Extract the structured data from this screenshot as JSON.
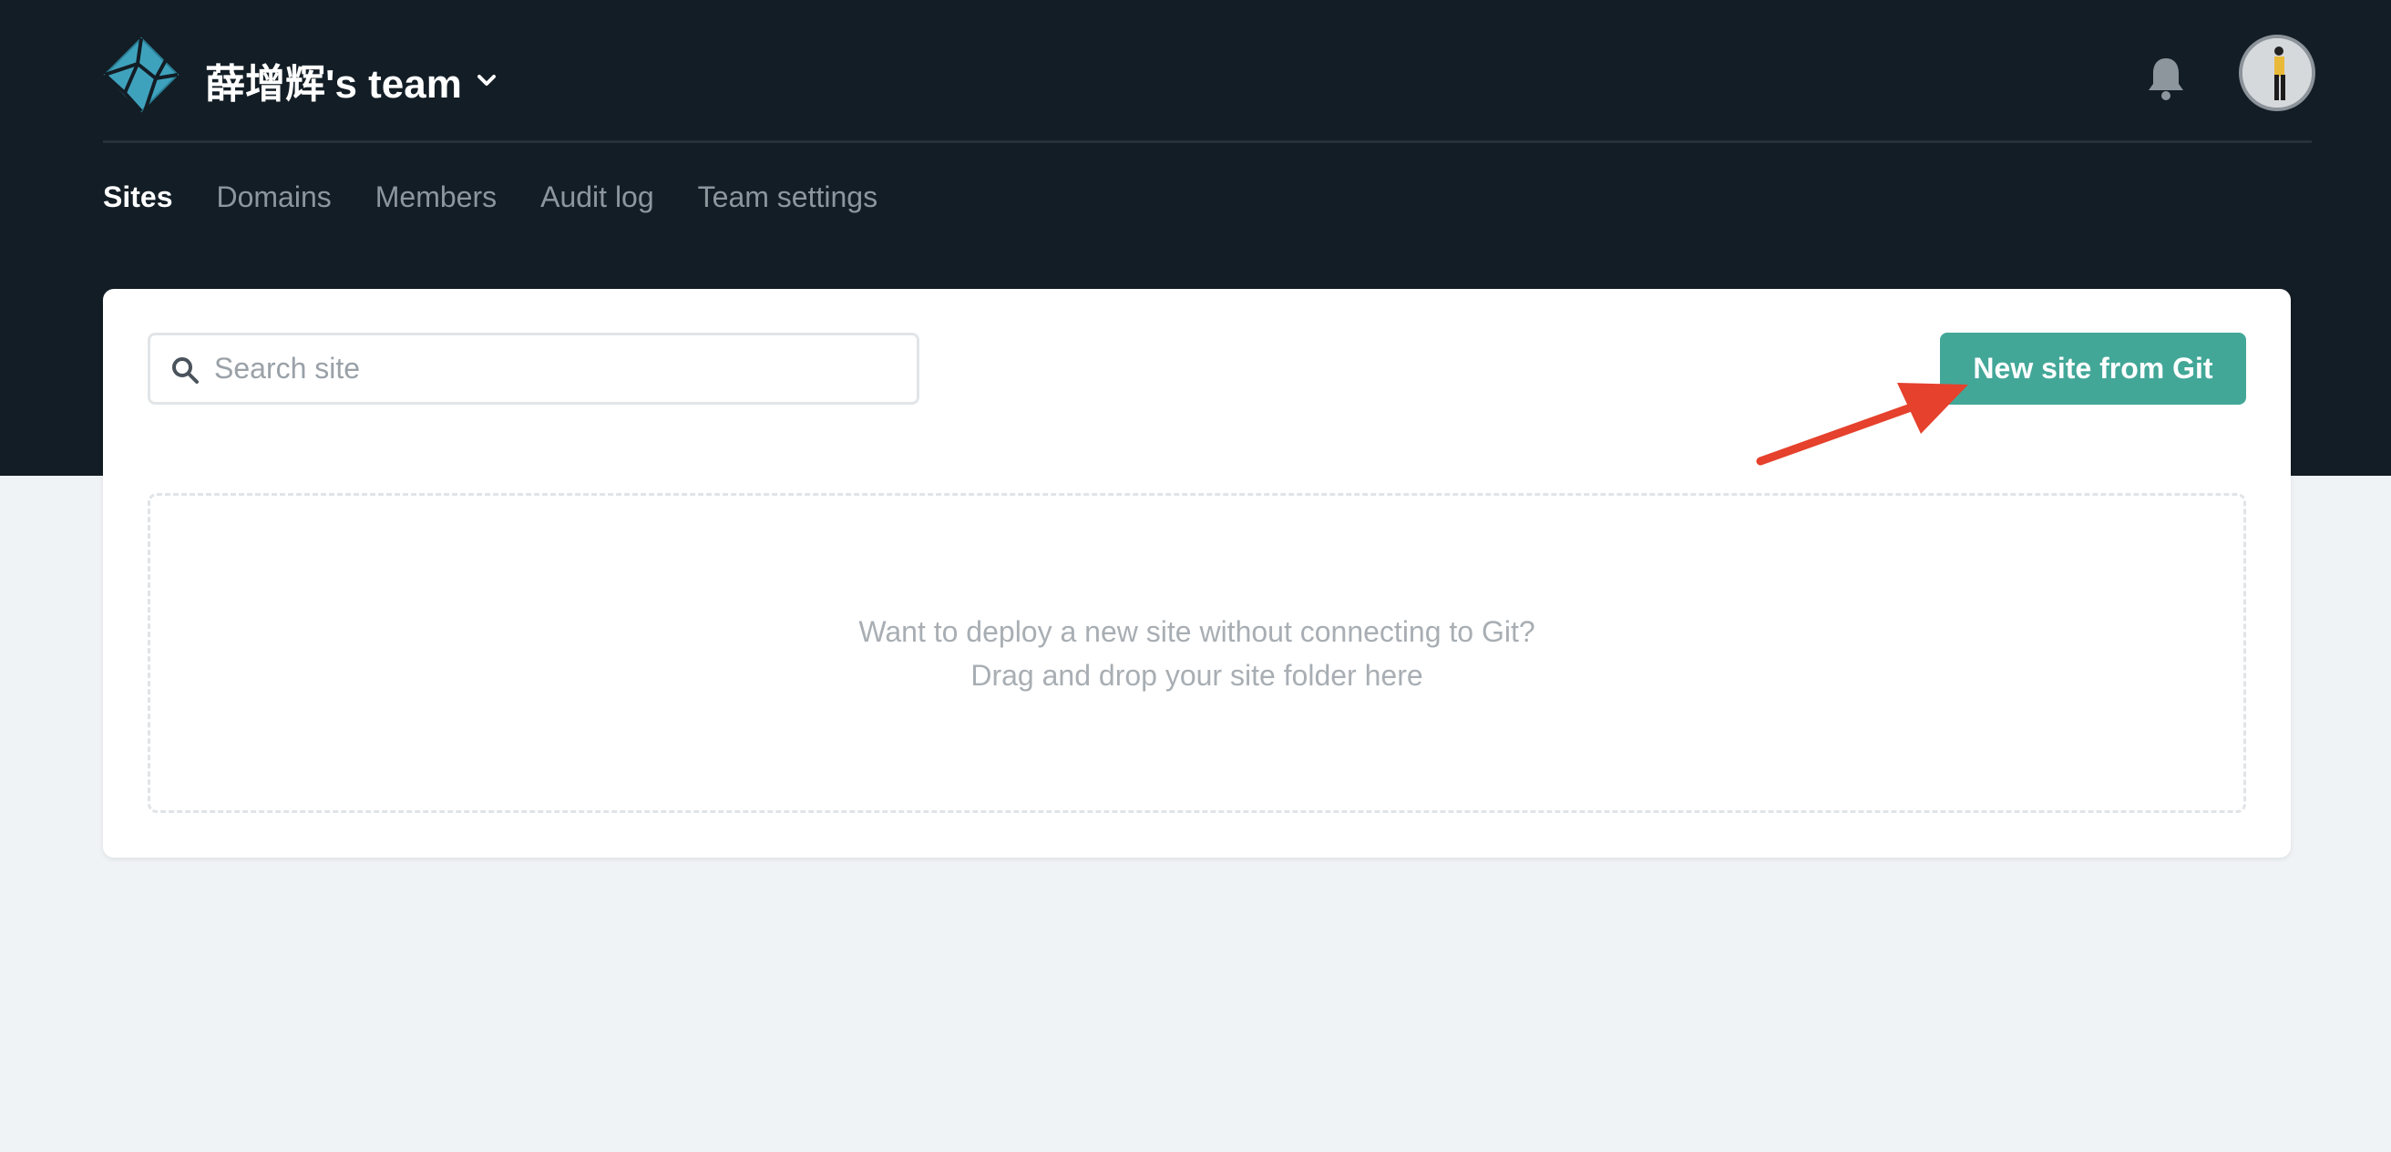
{
  "header": {
    "team_name": "薛增辉's team",
    "logo_icon": "netlify-logo-icon",
    "chevron_icon": "chevron-down-icon",
    "bell_icon": "bell-icon",
    "avatar_icon": "user-avatar"
  },
  "nav": {
    "items": [
      {
        "label": "Sites",
        "active": true
      },
      {
        "label": "Domains",
        "active": false
      },
      {
        "label": "Members",
        "active": false
      },
      {
        "label": "Audit log",
        "active": false
      },
      {
        "label": "Team settings",
        "active": false
      }
    ]
  },
  "main": {
    "search": {
      "placeholder": "Search site",
      "value": "",
      "icon": "search-icon"
    },
    "new_site_button": "New site from Git",
    "dropzone": {
      "line1": "Want to deploy a new site without connecting to Git?",
      "line2": "Drag and drop your site folder here"
    }
  },
  "colors": {
    "header_bg": "#131d25",
    "accent": "#43a798",
    "page_bg": "#f0f3f6",
    "annotation_arrow": "#e5412c"
  }
}
